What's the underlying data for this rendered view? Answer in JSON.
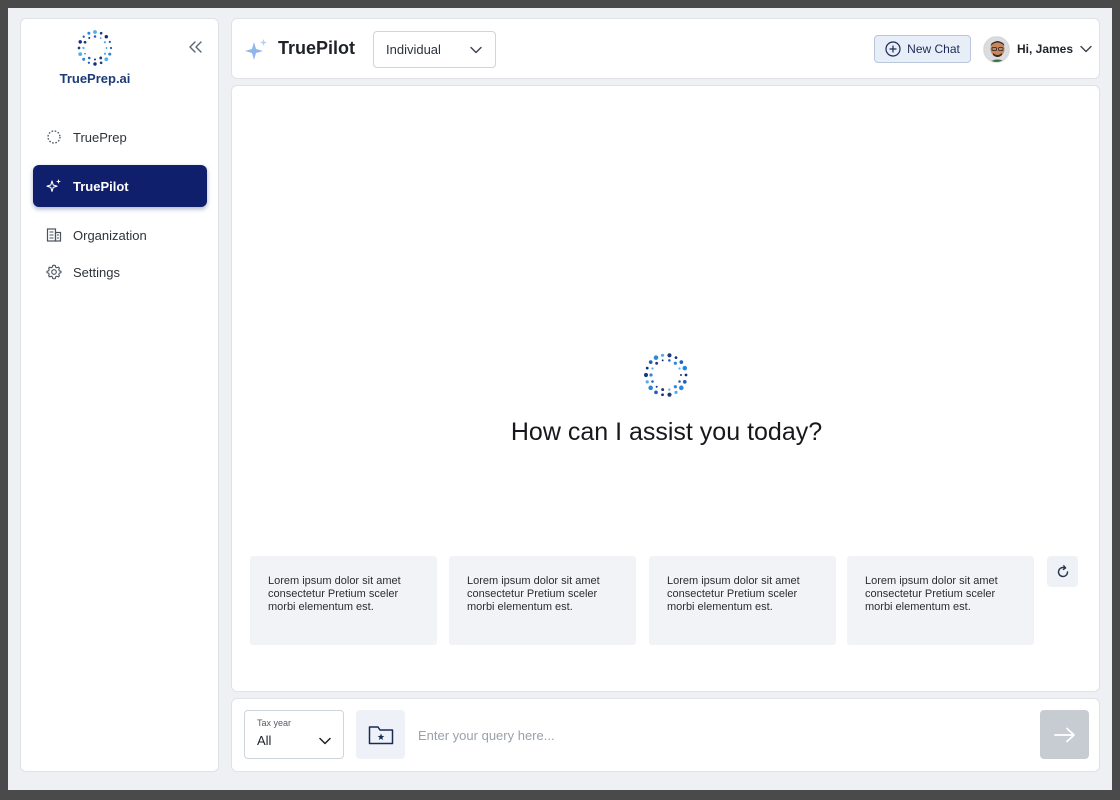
{
  "brand": {
    "name": "TruePrep.ai",
    "colors": {
      "primary": "#0f1f6b",
      "accent": "#2f7fd9",
      "logo_dark": "#1b3a78"
    }
  },
  "sidebar": {
    "collapse_icon": "chevrons-left-icon",
    "items": [
      {
        "label": "TruePrep",
        "icon": "dotted-circle-icon",
        "active": false
      },
      {
        "label": "TruePilot",
        "icon": "sparkles-icon",
        "active": true
      },
      {
        "label": "Organization",
        "icon": "building-icon",
        "active": false
      },
      {
        "label": "Settings",
        "icon": "gear-icon",
        "active": false
      }
    ]
  },
  "header": {
    "title": "TruePilot",
    "mode_select": {
      "value": "Individual"
    },
    "new_chat_label": "New Chat",
    "user_greeting": "Hi, James"
  },
  "main": {
    "heading": "How can I assist you today?",
    "suggestions": [
      "Lorem ipsum dolor sit amet consectetur Pretium sceler morbi elementum est.",
      "Lorem ipsum dolor sit amet consectetur Pretium sceler morbi elementum est.",
      "Lorem ipsum dolor sit amet consectetur Pretium sceler morbi elementum est.",
      "Lorem ipsum dolor sit amet consectetur Pretium sceler morbi elementum est."
    ],
    "refresh_icon": "refresh-icon"
  },
  "composer": {
    "tax_year_label": "Tax year",
    "tax_year_value": "All",
    "query_placeholder": "Enter your query here...",
    "query_value": "",
    "send_icon": "arrow-right-icon"
  }
}
